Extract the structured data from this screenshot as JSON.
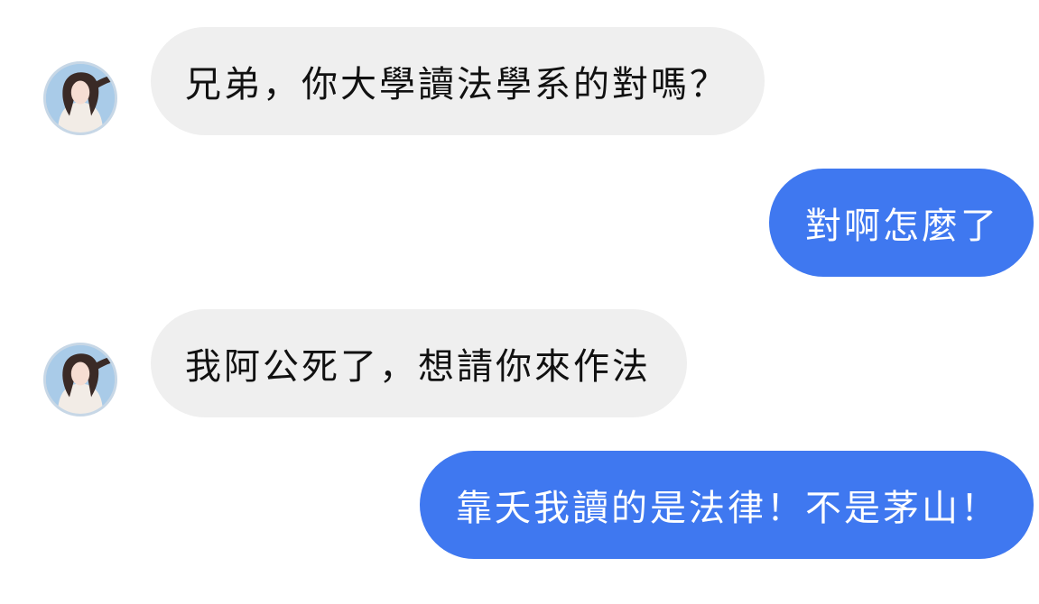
{
  "contact": {
    "avatar_icon": "profile-photo-avatar"
  },
  "colors": {
    "incoming_bubble": "#efefef",
    "outgoing_bubble": "#3f78f0",
    "incoming_text": "#111111",
    "outgoing_text": "#ffffff",
    "background": "#ffffff"
  },
  "messages": [
    {
      "sender": "them",
      "text": "兄弟，你大學讀法學系的對嗎？"
    },
    {
      "sender": "me",
      "text": "對啊怎麼了"
    },
    {
      "sender": "them",
      "text": "我阿公死了，想請你來作法"
    },
    {
      "sender": "me",
      "text": "靠夭我讀的是法律！不是茅山！"
    }
  ]
}
